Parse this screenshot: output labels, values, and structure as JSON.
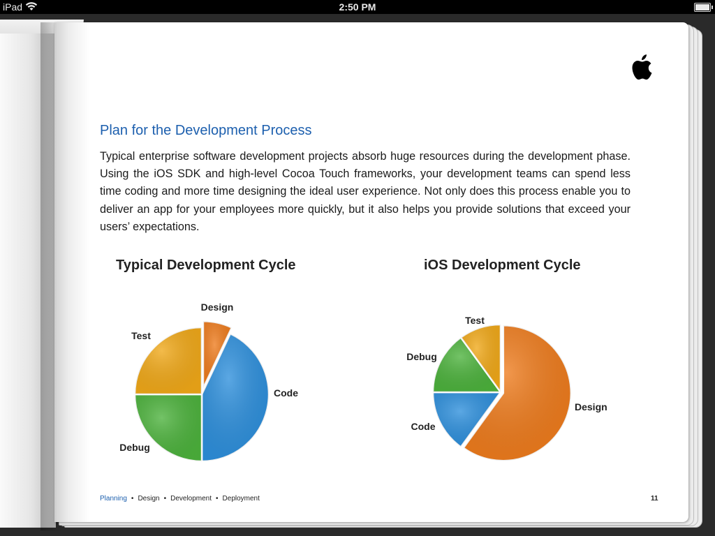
{
  "status_bar": {
    "device": "iPad",
    "wifi_icon": "wifi-icon",
    "time": "2:50 PM",
    "battery_icon": "battery-icon",
    "battery_level": 1.0
  },
  "page": {
    "logo_icon": "apple-logo-icon",
    "heading": "Plan for the Development Process",
    "body": "Typical enterprise software development projects absorb huge resources during the development phase. Using the iOS SDK and high-level Cocoa Touch frameworks, your development teams can spend less time coding and more time designing the ideal user experience. Not only does this process enable you to deliver an app for your employees more quickly, but it also helps you provide solutions that exceed your users’ expectations.",
    "footer_nav": [
      "Planning",
      "Design",
      "Development",
      "Deployment"
    ],
    "footer_separator": "•",
    "active_section": "Planning",
    "page_number": "11"
  },
  "colors": {
    "heading": "#1c5fae",
    "design": "#ee7b1c",
    "code": "#2d8fdc",
    "debug": "#4cb23c",
    "test": "#f0a818"
  },
  "chart_data": [
    {
      "type": "pie",
      "title": "Typical Development Cycle",
      "labels": [
        "Design",
        "Code",
        "Debug",
        "Test"
      ],
      "values": [
        7,
        43,
        25,
        25
      ],
      "exploded": [
        "Design"
      ],
      "colors": [
        "#ee7b1c",
        "#2d8fdc",
        "#4cb23c",
        "#f0a818"
      ]
    },
    {
      "type": "pie",
      "title": "iOS Development Cycle",
      "labels": [
        "Design",
        "Code",
        "Debug",
        "Test"
      ],
      "values": [
        60,
        15,
        15,
        10
      ],
      "exploded": [
        "Design"
      ],
      "colors": [
        "#ee7b1c",
        "#2d8fdc",
        "#4cb23c",
        "#f0a818"
      ]
    }
  ]
}
